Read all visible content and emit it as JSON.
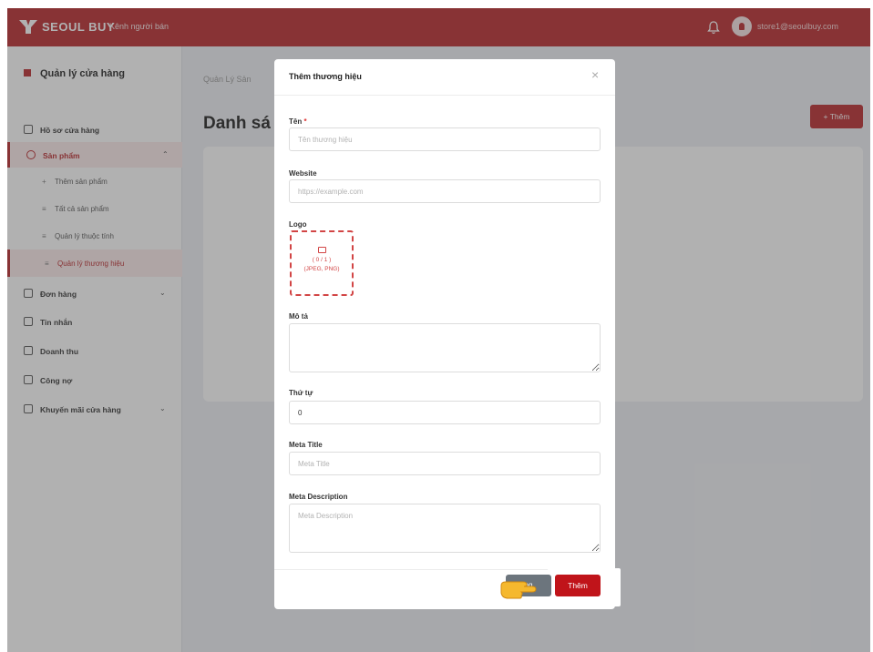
{
  "topbar": {
    "brand": "SEOUL BUY",
    "subtitle": "Kênh người bán",
    "user_email": "store1@seoulbuy.com",
    "bg_color": "#b8262a"
  },
  "sidebar": {
    "shop_title": "Quản lý cửa hàng",
    "items": [
      {
        "label": "Hồ sơ cửa hàng",
        "icon": "shop-icon"
      },
      {
        "label": "Sản phẩm",
        "icon": "box-icon",
        "active": true,
        "expanded": true
      },
      {
        "label": "Đơn hàng",
        "icon": "cart-icon"
      },
      {
        "label": "Tin nhắn",
        "icon": "chat-icon"
      },
      {
        "label": "Doanh thu",
        "icon": "chart-icon"
      },
      {
        "label": "Công nợ",
        "icon": "wallet-icon"
      },
      {
        "label": "Khuyến mãi cửa hàng",
        "icon": "tag-icon"
      }
    ],
    "sub_items": [
      {
        "label": "Thêm sản phẩm",
        "bullet": "+"
      },
      {
        "label": "Tất cả sản phẩm",
        "bullet": "≡"
      },
      {
        "label": "Quản lý thuộc tính",
        "bullet": "≡"
      },
      {
        "label": "Quản lý thương hiệu",
        "bullet": "≡",
        "active": true
      }
    ]
  },
  "main": {
    "breadcrumb": "Quản Lý Sản",
    "heading": "Danh sá",
    "add_button": "+ Thêm"
  },
  "modal": {
    "title": "Thêm thương hiệu",
    "close": "×",
    "fields": {
      "name_label": "Tên",
      "name_required": "*",
      "name_placeholder": "Tên thương hiệu",
      "website_label": "Website",
      "website_placeholder": "https://example.com",
      "logo_label": "Logo",
      "logo_count": "( 0 / 1 )",
      "logo_formats": "(JPEG, PNG)",
      "desc_label": "Mô tả",
      "order_label": "Thứ tự",
      "order_value": "0",
      "meta_title_label": "Meta Title",
      "meta_title_placeholder": "Meta Title",
      "meta_desc_label": "Meta Description",
      "meta_desc_placeholder": "Meta Description"
    },
    "cancel_button": "ng",
    "submit_button": "Thêm",
    "submit_color": "#c0141a"
  }
}
